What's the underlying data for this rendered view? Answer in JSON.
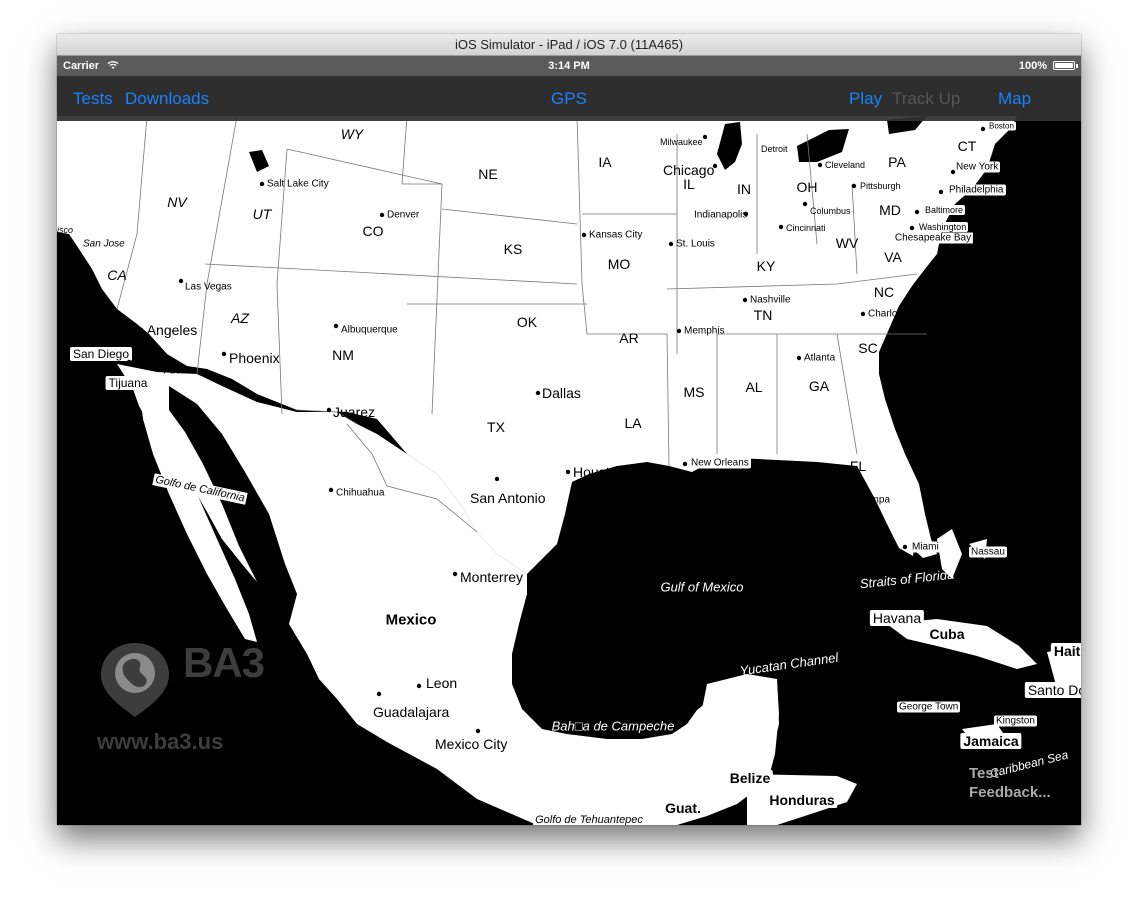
{
  "window": {
    "title": "iOS Simulator - iPad / iOS 7.0 (11A465)"
  },
  "status_bar": {
    "carrier": "Carrier",
    "time": "3:14 PM",
    "battery": "100%",
    "battery_level": 1.0
  },
  "nav": {
    "tests": "Tests",
    "downloads": "Downloads",
    "gps": "GPS",
    "play": "Play",
    "track_up": "Track Up",
    "map": "Map"
  },
  "map": {
    "states": [
      "WY",
      "NE",
      "IA",
      "IL",
      "IN",
      "OH",
      "PA",
      "CT",
      "NV",
      "UT",
      "CO",
      "KS",
      "MO",
      "KY",
      "WV",
      "VA",
      "MD",
      "CA",
      "AZ",
      "NM",
      "OK",
      "AR",
      "TN",
      "NC",
      "SC",
      "MS",
      "AL",
      "GA",
      "TX",
      "LA",
      "FL"
    ],
    "cities": [
      "Salt Lake City",
      "Denver",
      "Las Vegas",
      "San Jose",
      "Los Angeles",
      "San Diego",
      "Tijuana",
      "Puebla",
      "Phoenix",
      "Albuquerque",
      "Juarez",
      "Chihuahua",
      "Dallas",
      "Houston",
      "San Antonio",
      "Monterrey",
      "Leon",
      "Guadalajara",
      "Mexico City",
      "Kansas City",
      "St. Louis",
      "Chicago",
      "Milwaukee",
      "Detroit",
      "Cleveland",
      "Pittsburgh",
      "Columbus",
      "Indianapolis",
      "Cincinnati",
      "Nashville",
      "Memphis",
      "Atlanta",
      "Charlotte",
      "New Orleans",
      "Tampa",
      "Miami",
      "Nassau",
      "Havana",
      "George Town",
      "Kingston",
      "New York",
      "Philadelphia",
      "Baltimore",
      "Washington",
      "Boston"
    ],
    "water": [
      "Golfo de California",
      "Gulf of Mexico",
      "Straits of Florida",
      "Yucatan Channel",
      "Bah□a de Campeche",
      "Golfo de Tehuantepec",
      "Caribbean Sea",
      "Chesapeake Bay"
    ],
    "countries": [
      "Mexico",
      "Cuba",
      "Haiti",
      "Santo Do",
      "Jamaica",
      "Belize",
      "Honduras",
      "Guat."
    ],
    "partial": [
      "isco"
    ]
  },
  "watermark": {
    "brand": "BA3",
    "url": "www.ba3.us"
  },
  "overlay": {
    "test": "Test",
    "feedback": "Feedback..."
  }
}
